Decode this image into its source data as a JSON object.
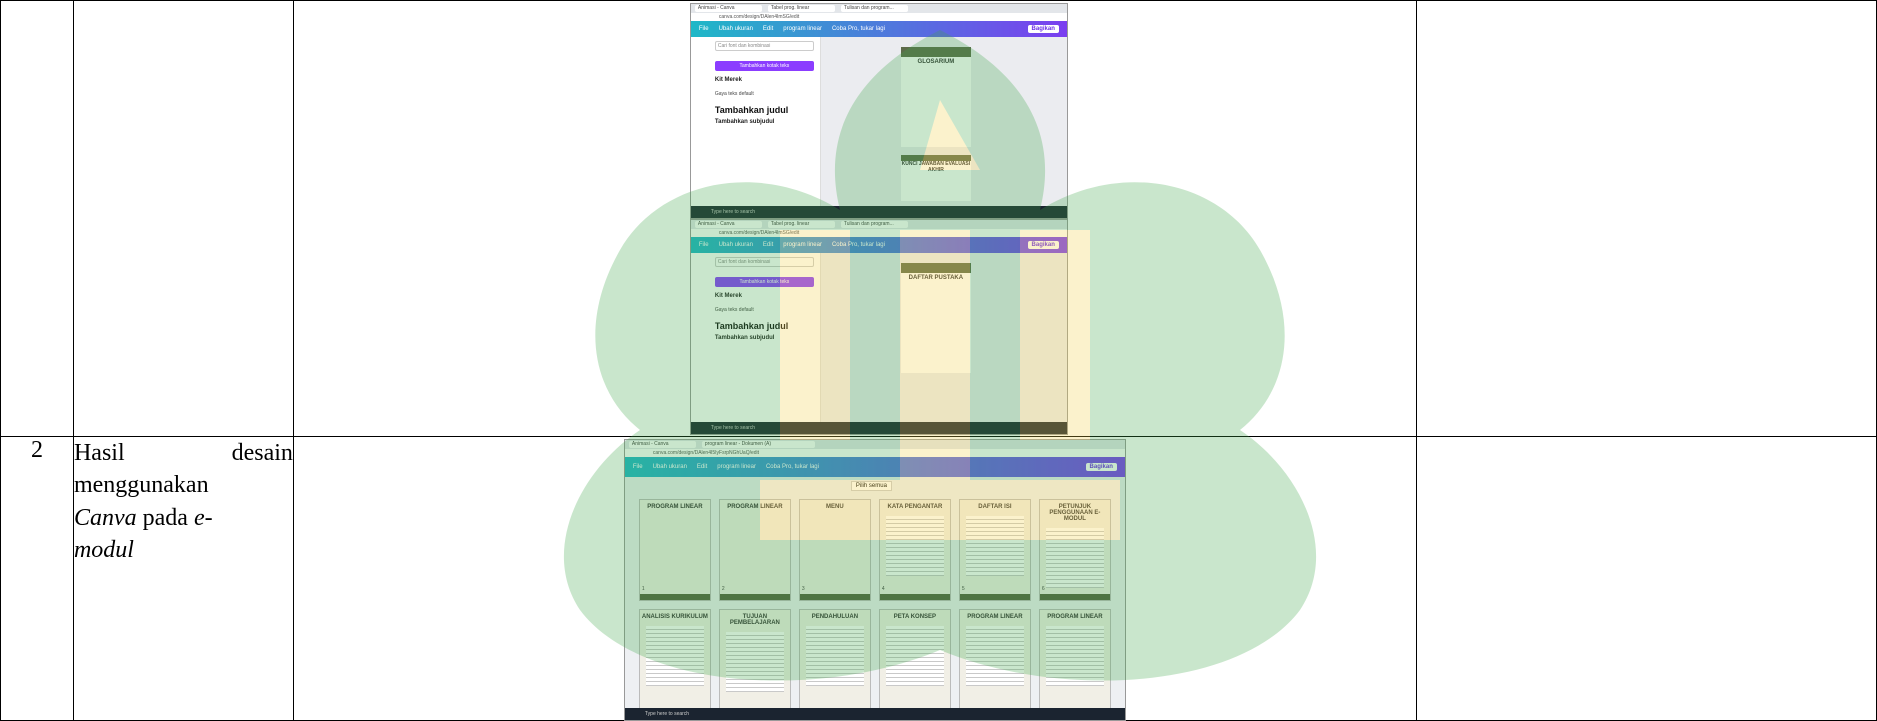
{
  "row2": {
    "number": "2",
    "desc_line1_a": "Hasil",
    "desc_line1_b": "desain",
    "desc_line2": "menggunakan",
    "desc_line3_italic": "Canva",
    "desc_line3_mid": " pada ",
    "desc_line3_end": "e-",
    "desc_line4_italic": "modul"
  },
  "shot_top": {
    "tabs": [
      "Animasi - Canva",
      "Tabel prog. linear",
      "Tulisan dan program..."
    ],
    "url": "canva.com/design/DAlen4ImSG/edit",
    "menu": [
      "File",
      "Ubah ukuran",
      "Edit",
      "program linear",
      "Coba Pro, tukar lagi"
    ],
    "share": "Bagikan",
    "search_placeholder": "Cari font dan kombinasi",
    "add_text": "Tambahkan kotak teks",
    "brand_kit": "Kit Merek",
    "default_styles": "Gaya teks default",
    "heading": "Tambahkan judul",
    "subheading": "Tambahkan subjudul",
    "page_title_1": "GLOSARIUM",
    "page_title_2": "KUNCI JAWABAN EVALUASI AKHIR",
    "page_title_3": "DAFTAR PUSTAKA",
    "taskbar": "Type here to search"
  },
  "shot_bottom": {
    "tabs": [
      "Animasi - Canva",
      "program linear - Dokumen (A)"
    ],
    "url": "canva.com/design/DAlen4I5IyFsrpNGhUaQ/edit",
    "menu": [
      "File",
      "Ubah ukuran",
      "Edit",
      "program linear",
      "Coba Pro, tukar lagi"
    ],
    "share": "Bagikan",
    "select_all": "Pilih semua",
    "pages": [
      "PROGRAM LINEAR",
      "PROGRAM LINEAR",
      "MENU",
      "KATA PENGANTAR",
      "DAFTAR ISI",
      "PETUNJUK PENGGUNAAN E-MODUL",
      "ANALISIS KURIKULUM",
      "TUJUAN PEMBELAJARAN",
      "PENDAHULUAN",
      "PETA KONSEP",
      "PROGRAM LINEAR",
      "PROGRAM LINEAR"
    ],
    "page_numbers": [
      "1",
      "2",
      "3",
      "4",
      "5",
      "6"
    ],
    "taskbar": "Type here to search"
  },
  "colors": {
    "canva_cyan": "#1fb8c7",
    "canva_purple": "#7b3ef0",
    "module_green": "#5d6b4a",
    "watermark_green": "#4caf50",
    "watermark_gold": "#e0b400"
  }
}
